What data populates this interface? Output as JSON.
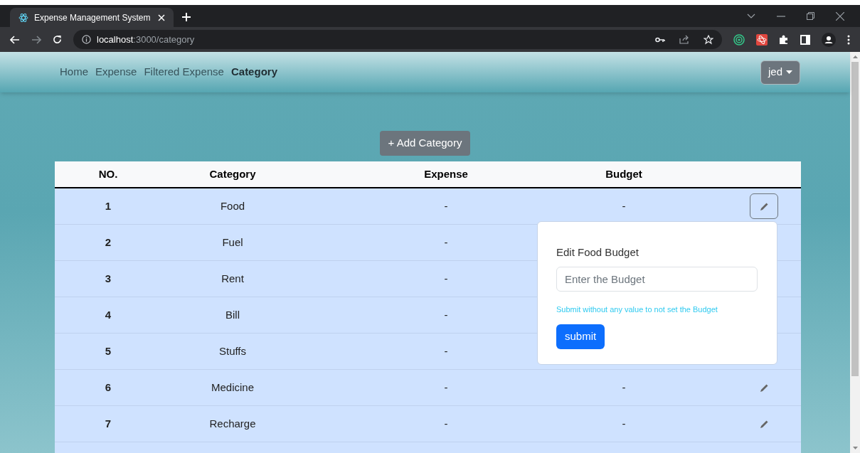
{
  "browser": {
    "tab_title": "Expense Management System",
    "url_host": "localhost",
    "url_rest": ":3000/category"
  },
  "navbar": {
    "links": [
      {
        "label": "Home",
        "selected": false
      },
      {
        "label": "Expense",
        "selected": false
      },
      {
        "label": "Filtered Expense",
        "selected": false
      },
      {
        "label": "Category",
        "selected": true
      }
    ],
    "user": "jed"
  },
  "add_button": "+ Add Category",
  "table": {
    "columns": [
      "NO.",
      "Category",
      "Expense",
      "Budget"
    ],
    "rows": [
      {
        "no": "1",
        "category": "Food",
        "expense": "-",
        "budget": "-",
        "edit_active": true
      },
      {
        "no": "2",
        "category": "Fuel",
        "expense": "-"
      },
      {
        "no": "3",
        "category": "Rent",
        "expense": "-"
      },
      {
        "no": "4",
        "category": "Bill",
        "expense": "-"
      },
      {
        "no": "5",
        "category": "Stuffs",
        "expense": "-"
      },
      {
        "no": "6",
        "category": "Medicine",
        "expense": "-",
        "budget": "-",
        "edit_active": false
      },
      {
        "no": "7",
        "category": "Recharge",
        "expense": "-",
        "budget": "-",
        "edit_active": false
      }
    ]
  },
  "popover": {
    "title": "Edit Food Budget",
    "placeholder": "Enter the Budget",
    "hint": "Submit without any value to not set the Budget",
    "submit": "submit"
  }
}
